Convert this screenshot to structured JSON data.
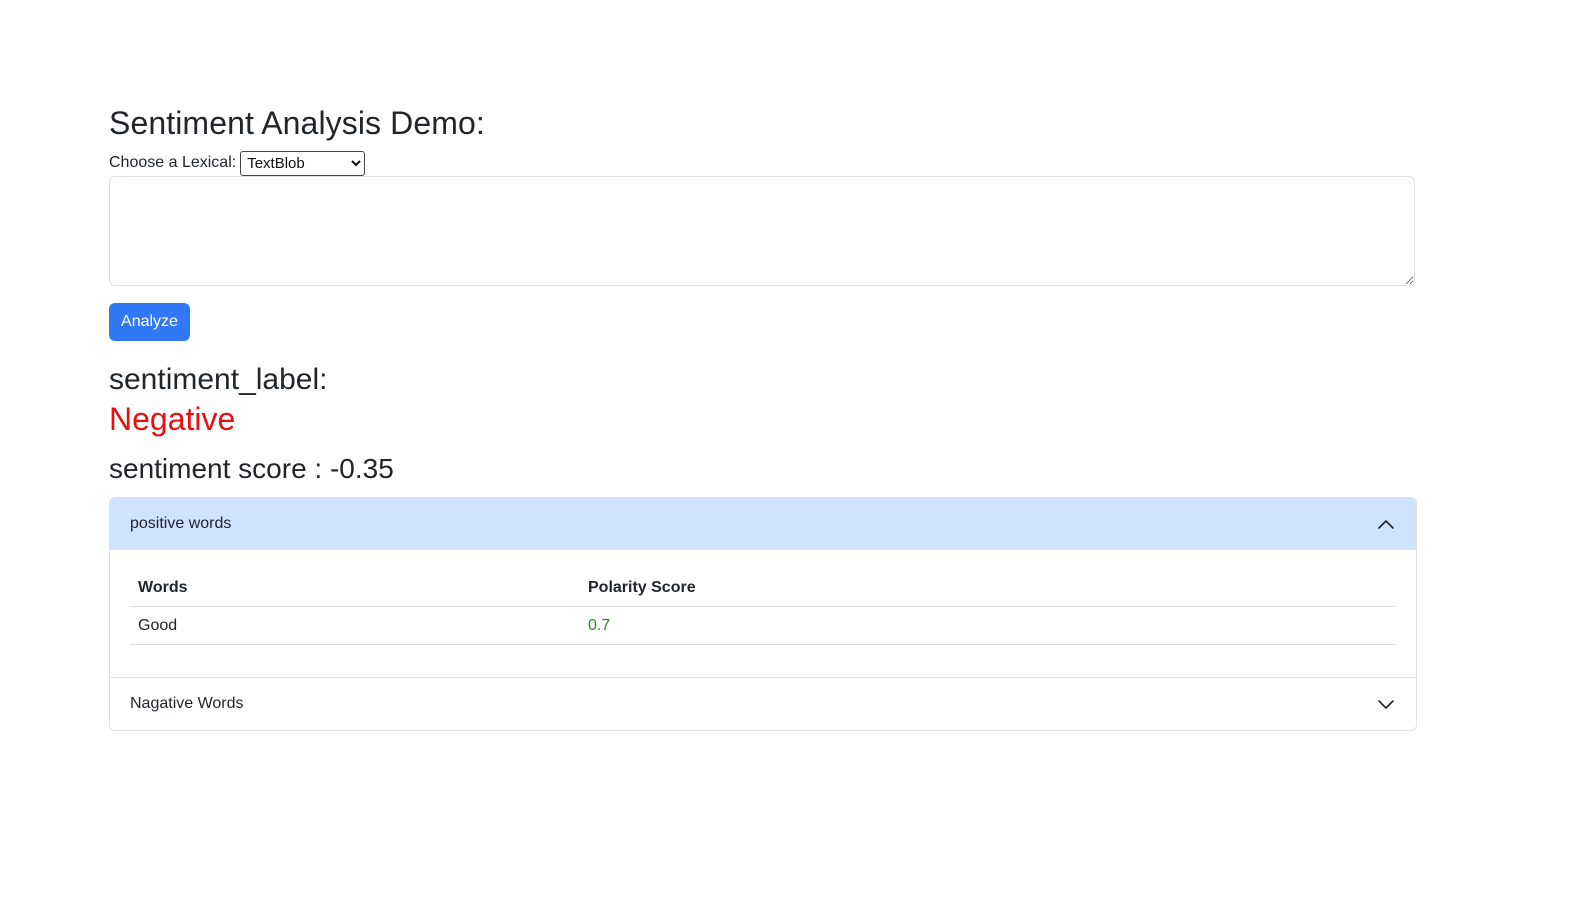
{
  "page": {
    "title": "Sentiment Analysis Demo:"
  },
  "lexical": {
    "label": "Choose a Lexical:",
    "selected": "TextBlob",
    "options": [
      "TextBlob"
    ]
  },
  "input": {
    "value": "",
    "placeholder": ""
  },
  "analyze_button": {
    "label": "Analyze",
    "color": "#3178f6"
  },
  "result": {
    "label_heading": "sentiment_label:",
    "label_value": "Negative",
    "label_color": "#e90f0f",
    "score_heading": "sentiment score : -0.35"
  },
  "accordion": {
    "positive": {
      "header": "positive words",
      "expanded": true,
      "columns": [
        "Words",
        "Polarity Score"
      ],
      "rows": [
        {
          "word": "Good",
          "score": "0.7"
        }
      ]
    },
    "negative": {
      "header": "Nagative Words",
      "expanded": false
    }
  },
  "icons": {
    "positive_toggle": "chevron-up-icon",
    "negative_toggle": "chevron-down-icon"
  }
}
